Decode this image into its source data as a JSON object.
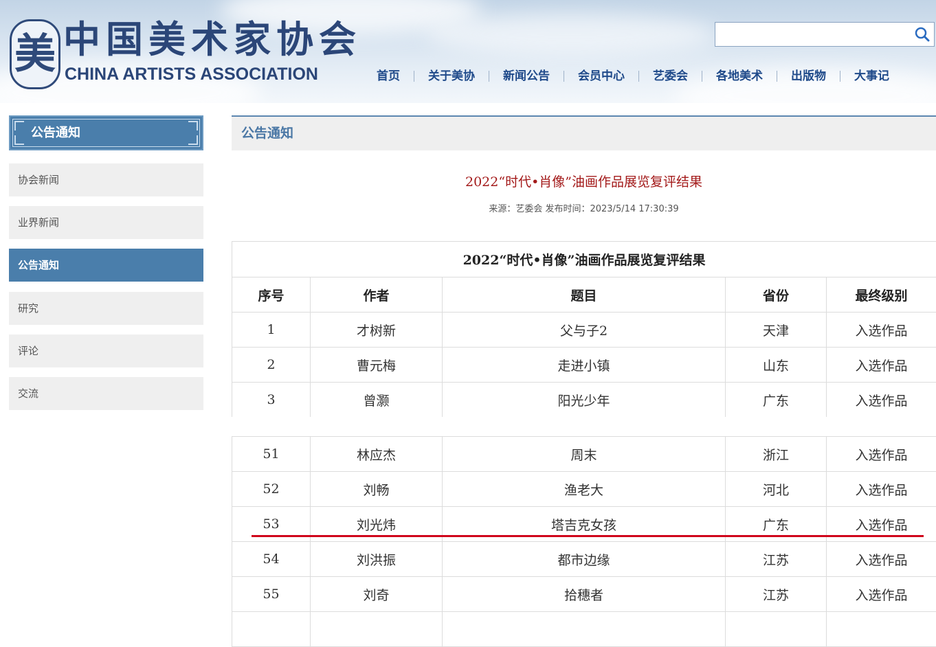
{
  "header": {
    "logo_cn": "中国美术家协会",
    "logo_en": "CHINA ARTISTS ASSOCIATION",
    "search": {
      "value": "",
      "placeholder": ""
    },
    "nav": [
      "首页",
      "关于美协",
      "新闻公告",
      "会员中心",
      "艺委会",
      "各地美术",
      "出版物",
      "大事记"
    ]
  },
  "sidebar": {
    "title": "公告通知",
    "items": [
      {
        "label": "协会新闻",
        "active": false
      },
      {
        "label": "业界新闻",
        "active": false
      },
      {
        "label": "公告通知",
        "active": true
      },
      {
        "label": "研究",
        "active": false
      },
      {
        "label": "评论",
        "active": false
      },
      {
        "label": "交流",
        "active": false
      }
    ]
  },
  "main": {
    "section_title": "公告通知",
    "article": {
      "title": "2022“时代•肖像”油画作品展览复评结果",
      "meta": "来源：艺委会 发布时间：2023/5/14 17:30:39"
    },
    "table": {
      "caption": "2022“时代•肖像”油画作品展览复评结果",
      "headers": [
        "序号",
        "作者",
        "题目",
        "省份",
        "最终级别"
      ],
      "rows_top": [
        [
          "1",
          "才树新",
          "父与子2",
          "天津",
          "入选作品"
        ],
        [
          "2",
          "曹元梅",
          "走进小镇",
          "山东",
          "入选作品"
        ],
        [
          "3",
          "曾灏",
          "阳光少年",
          "广东",
          "入选作品"
        ]
      ],
      "rows_bottom": [
        [
          "51",
          "林应杰",
          "周末",
          "浙江",
          "入选作品"
        ],
        [
          "52",
          "刘畅",
          "渔老大",
          "河北",
          "入选作品"
        ],
        [
          "53",
          "刘光炜",
          "塔吉克女孩",
          "广东",
          "入选作品"
        ],
        [
          "54",
          "刘洪振",
          "都市边缘",
          "江苏",
          "入选作品"
        ],
        [
          "55",
          "刘奇",
          "拾穗者",
          "江苏",
          "入选作品"
        ]
      ]
    }
  },
  "colors": {
    "accent": "#4a7eab",
    "title_red": "#a31a1a",
    "highlight_red": "#d0021b",
    "nav_blue": "#1f4a8a"
  }
}
